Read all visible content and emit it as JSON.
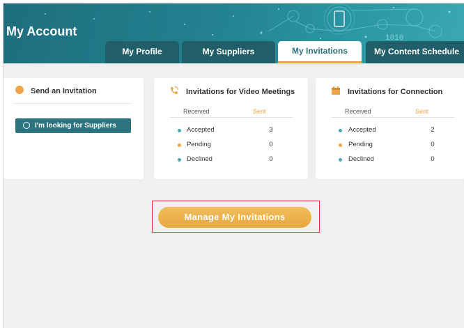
{
  "header": {
    "title": "My Account",
    "deco_text": "1010"
  },
  "tabs": [
    {
      "label": "My Profile",
      "active": false
    },
    {
      "label": "My Suppliers",
      "active": false
    },
    {
      "label": "My Invitations",
      "active": true
    },
    {
      "label": "My Content Schedule",
      "active": false
    }
  ],
  "send_card": {
    "title": "Send an Invitation",
    "button_label": "I'm looking for Suppliers"
  },
  "video_card": {
    "title": "Invitations for Video Meetings",
    "col_received": "Received",
    "col_sent": "Sent",
    "rows": [
      {
        "label": "Accepted",
        "value": "3"
      },
      {
        "label": "Pending",
        "value": "0"
      },
      {
        "label": "Declined",
        "value": "0"
      }
    ]
  },
  "connection_card": {
    "title": "Invitations for Connection",
    "col_received": "Received",
    "col_sent": "Sent",
    "rows": [
      {
        "label": "Accepted",
        "value": "2"
      },
      {
        "label": "Pending",
        "value": "0"
      },
      {
        "label": "Declined",
        "value": "0"
      }
    ]
  },
  "manage_button": {
    "label": "Manage My Invitations"
  },
  "colors": {
    "teal": "#2b7480",
    "orange": "#eda548",
    "accepted": "#4aa4b0",
    "pending": "#eda548",
    "declined": "#4aa4b0",
    "highlight_border": "#d6363a"
  }
}
